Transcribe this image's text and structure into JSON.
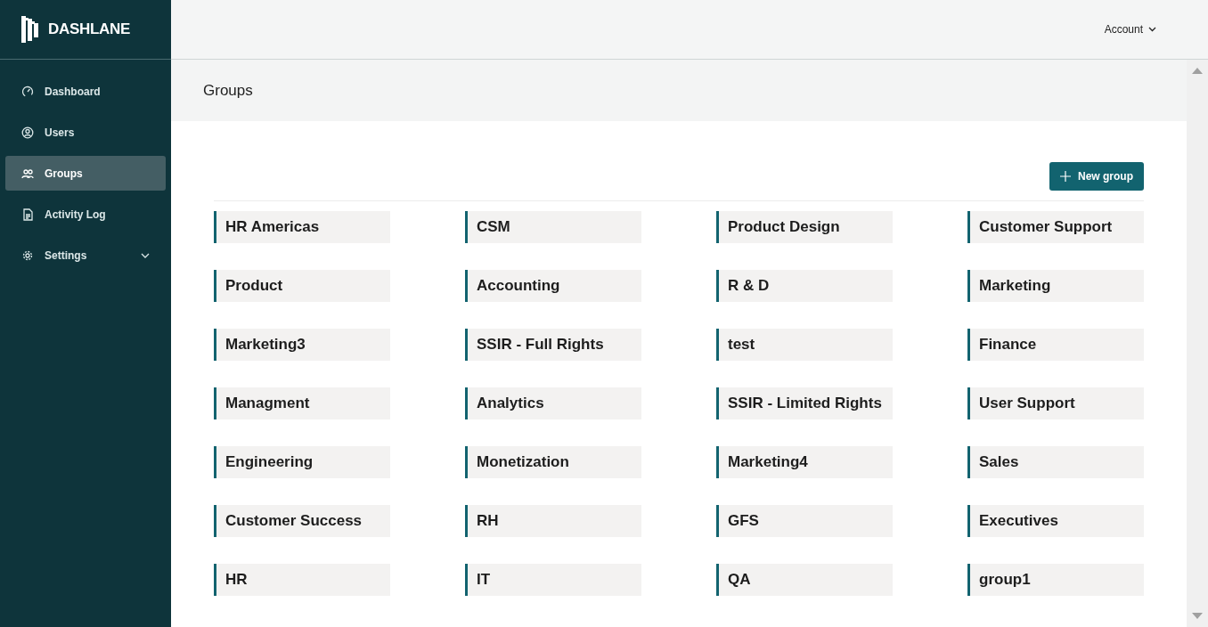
{
  "brand": {
    "name": "DASHLANE"
  },
  "sidebar": {
    "items": [
      {
        "label": "Dashboard",
        "selected": false
      },
      {
        "label": "Users",
        "selected": false
      },
      {
        "label": "Groups",
        "selected": true
      },
      {
        "label": "Activity Log",
        "selected": false
      },
      {
        "label": "Settings",
        "kind": "menu",
        "selected": false,
        "expanded": false
      }
    ]
  },
  "header": {
    "account": "Account"
  },
  "page": {
    "title": "Groups",
    "new_button": "New group",
    "groups": [
      "HR Americas",
      "CSM",
      "Product Design",
      "Customer Support",
      "Product",
      "Accounting",
      "R & D",
      "Marketing",
      "Marketing3",
      "SSIR - Full Rights",
      "test",
      "Finance",
      "Managment",
      "Analytics",
      "SSIR - Limited Rights",
      "User Support",
      "Engineering",
      "Monetization",
      "Marketing4",
      "Sales",
      "Customer Success",
      "RH",
      "GFS",
      "Executives",
      "HR",
      "IT",
      "QA",
      "group1"
    ]
  }
}
